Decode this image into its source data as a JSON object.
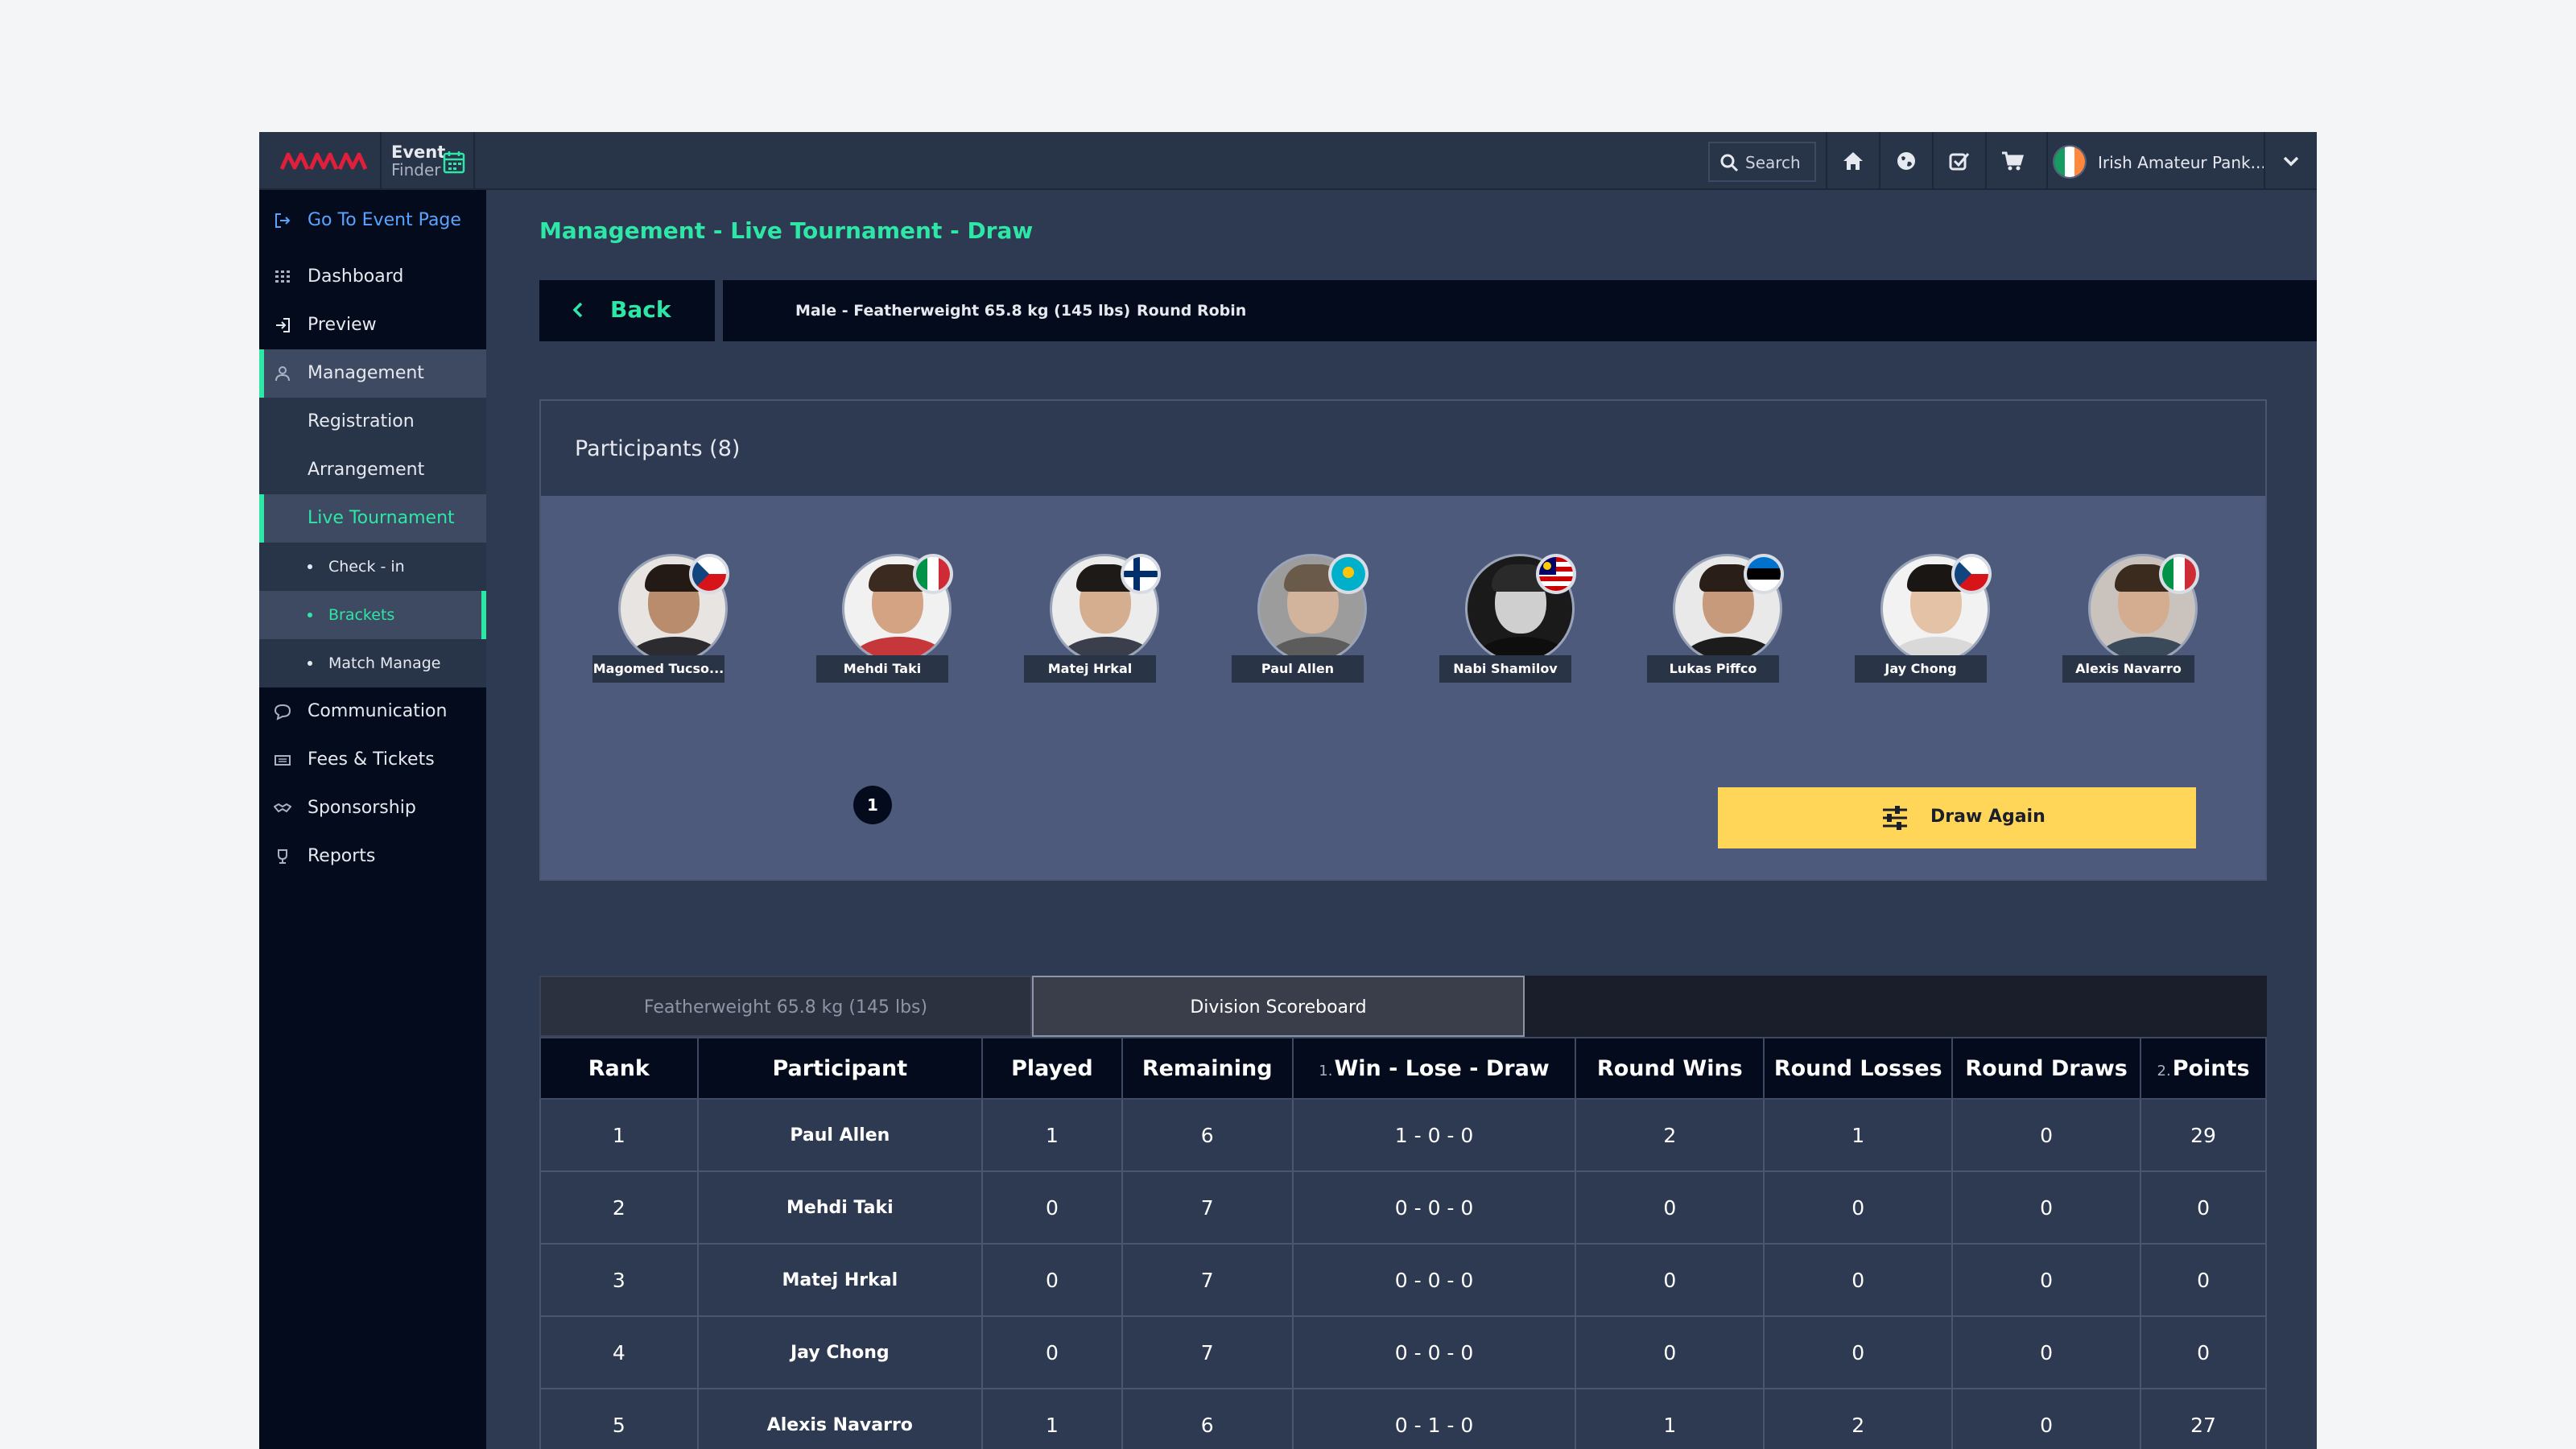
{
  "topbar": {
    "event_finder_line1": "Event",
    "event_finder_line2": "Finder",
    "search_label": "Search",
    "user_name": "Irish Amateur Pank...",
    "user_flag_colors": [
      "#169b62",
      "#ffffff",
      "#ff883e"
    ],
    "icons": [
      "home-icon",
      "globe-icon",
      "checklist-icon",
      "cart-icon"
    ]
  },
  "sidebar": {
    "go_to_event": "Go To Event Page",
    "dashboard": "Dashboard",
    "preview": "Preview",
    "management": "Management",
    "registration": "Registration",
    "arrangement": "Arrangement",
    "live_tournament": "Live Tournament",
    "check_in": "Check - in",
    "brackets": "Brackets",
    "match_manage": "Match Manage",
    "communication": "Communication",
    "fees_tickets": "Fees & Tickets",
    "sponsorship": "Sponsorship",
    "reports": "Reports"
  },
  "main": {
    "title": "Management - Live Tournament - Draw",
    "back_label": "Back",
    "division": "Male - Featherweight 65.8 kg (145 lbs)",
    "mode": "Round Robin",
    "participants_heading": "Participants (8)",
    "seed_number": "1",
    "draw_again_label": "Draw Again"
  },
  "participants": [
    {
      "name": "Magomed Tucso...",
      "flag": "czech"
    },
    {
      "name": "Mehdi Taki",
      "flag": "italy"
    },
    {
      "name": "Matej Hrkal",
      "flag": "finland"
    },
    {
      "name": "Paul Allen",
      "flag": "kazakhstan"
    },
    {
      "name": "Nabi Shamilov",
      "flag": "malaysia"
    },
    {
      "name": "Lukas Piffco",
      "flag": "estonia"
    },
    {
      "name": "Jay Chong",
      "flag": "czech"
    },
    {
      "name": "Alexis Navarro",
      "flag": "italy"
    }
  ],
  "tabs": {
    "weight": "Featherweight 65.8 kg (145 lbs)",
    "scoreboard": "Division Scoreboard"
  },
  "table": {
    "headers": {
      "rank": "Rank",
      "participant": "Participant",
      "played": "Played",
      "remaining": "Remaining",
      "wld_prefix": "1.",
      "wld": "Win - Lose - Draw",
      "round_wins": "Round Wins",
      "round_losses": "Round Losses",
      "round_draws": "Round Draws",
      "points_prefix": "2.",
      "points": "Points"
    },
    "rows": [
      {
        "rank": "1",
        "participant": "Paul Allen",
        "played": "1",
        "remaining": "6",
        "wld": "1 - 0 - 0",
        "round_wins": "2",
        "round_losses": "1",
        "round_draws": "0",
        "points": "29"
      },
      {
        "rank": "2",
        "participant": "Mehdi Taki",
        "played": "0",
        "remaining": "7",
        "wld": "0 - 0 - 0",
        "round_wins": "0",
        "round_losses": "0",
        "round_draws": "0",
        "points": "0"
      },
      {
        "rank": "3",
        "participant": "Matej Hrkal",
        "played": "0",
        "remaining": "7",
        "wld": "0 - 0 - 0",
        "round_wins": "0",
        "round_losses": "0",
        "round_draws": "0",
        "points": "0"
      },
      {
        "rank": "4",
        "participant": "Jay Chong",
        "played": "0",
        "remaining": "7",
        "wld": "0 - 0 - 0",
        "round_wins": "0",
        "round_losses": "0",
        "round_draws": "0",
        "points": "0"
      },
      {
        "rank": "5",
        "participant": "Alexis Navarro",
        "played": "1",
        "remaining": "6",
        "wld": "0 - 1 - 0",
        "round_wins": "1",
        "round_losses": "2",
        "round_draws": "0",
        "points": "27"
      }
    ]
  },
  "colors": {
    "accent": "#2ee6a6",
    "link": "#5aa3ff",
    "draw_button": "#ffd658",
    "sidebar_bg": "#040b1c",
    "app_bg": "#2d3a52",
    "participants_bg": "#4d5a7c"
  }
}
